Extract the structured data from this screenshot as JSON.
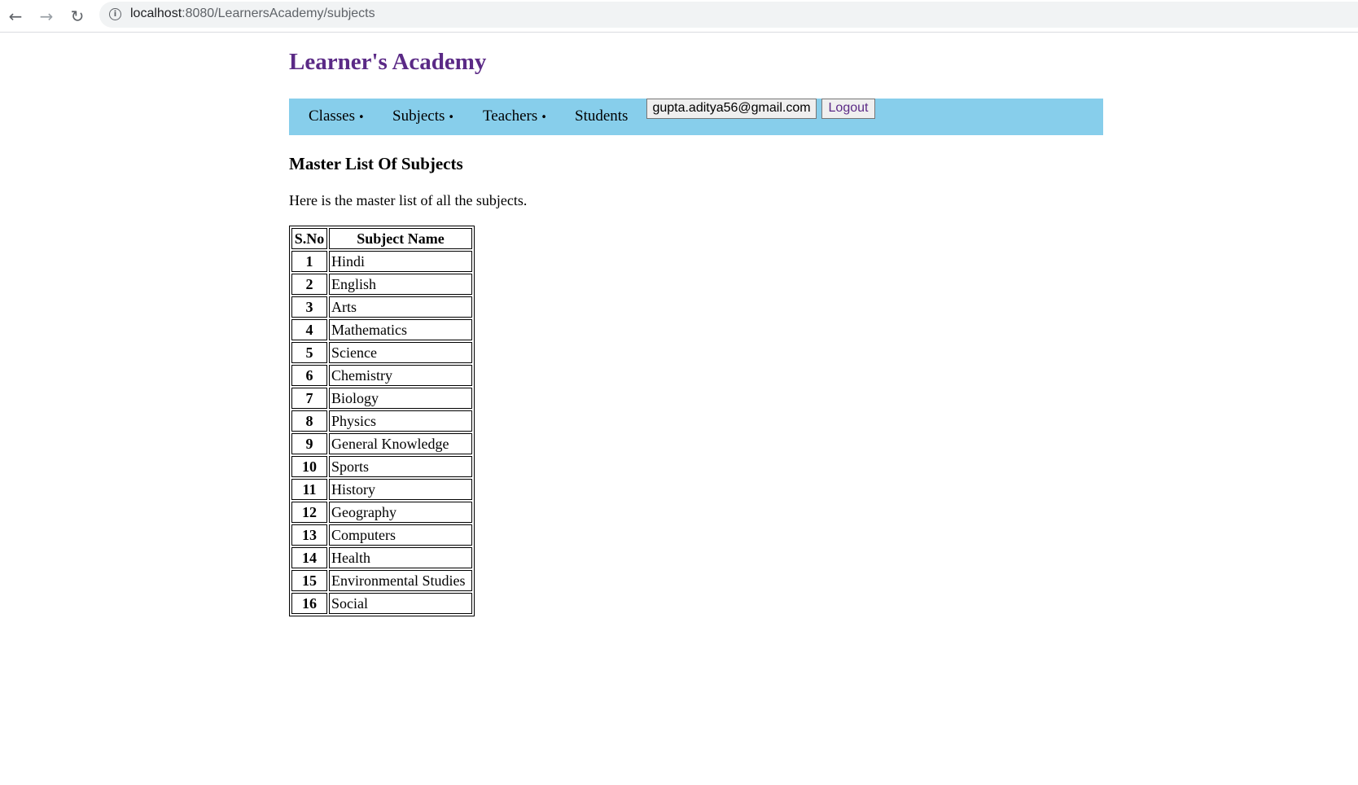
{
  "browser": {
    "back_icon": "←",
    "forward_icon": "→",
    "reload_icon": "↻",
    "info_icon": "i",
    "url_host": "localhost",
    "url_rest": ":8080/LearnersAcademy/subjects"
  },
  "site": {
    "title": "Learner's Academy",
    "title_color": "#5b2a86",
    "nav_background": "#87ceeb"
  },
  "nav": {
    "classes": "Classes",
    "subjects": "Subjects",
    "teachers": "Teachers",
    "students": "Students",
    "bullet": "•",
    "user_email": "gupta.aditya56@gmail.com",
    "logout": "Logout"
  },
  "main": {
    "heading": "Master List Of Subjects",
    "intro": "Here is the master list of all the subjects."
  },
  "table": {
    "headers": [
      "S.No",
      "Subject Name"
    ],
    "rows": [
      {
        "sno": "1",
        "name": "Hindi"
      },
      {
        "sno": "2",
        "name": "English"
      },
      {
        "sno": "3",
        "name": "Arts"
      },
      {
        "sno": "4",
        "name": "Mathematics"
      },
      {
        "sno": "5",
        "name": "Science"
      },
      {
        "sno": "6",
        "name": "Chemistry"
      },
      {
        "sno": "7",
        "name": "Biology"
      },
      {
        "sno": "8",
        "name": "Physics"
      },
      {
        "sno": "9",
        "name": "General Knowledge"
      },
      {
        "sno": "10",
        "name": "Sports"
      },
      {
        "sno": "11",
        "name": "History"
      },
      {
        "sno": "12",
        "name": "Geography"
      },
      {
        "sno": "13",
        "name": "Computers"
      },
      {
        "sno": "14",
        "name": "Health"
      },
      {
        "sno": "15",
        "name": "Environmental Studies"
      },
      {
        "sno": "16",
        "name": "Social"
      }
    ]
  }
}
